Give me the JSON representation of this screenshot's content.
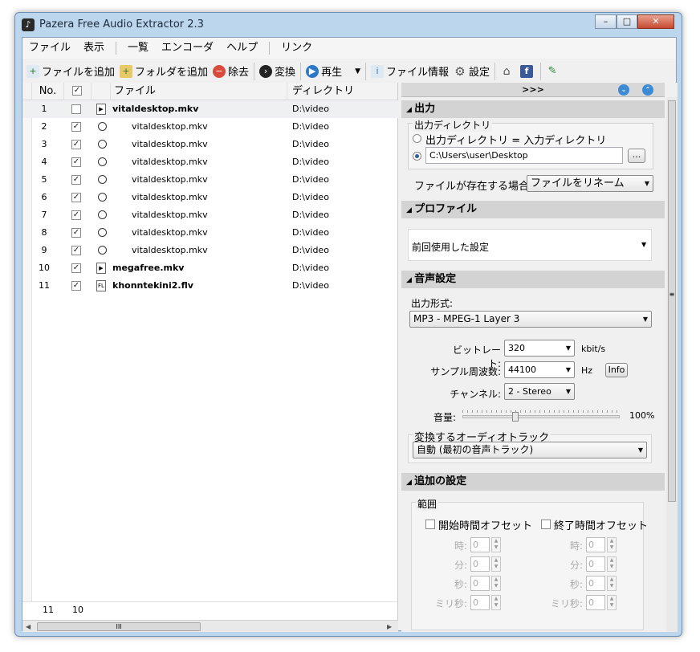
{
  "window": {
    "title": "Pazera Free Audio Extractor 2.3"
  },
  "menu": [
    "ファイル",
    "表示",
    "一覧",
    "エンコーダ",
    "ヘルプ",
    "リンク"
  ],
  "toolbar": {
    "add_file": "ファイルを追加",
    "add_folder": "フォルダを追加",
    "remove": "除去",
    "convert": "変換",
    "play": "再生",
    "file_info": "ファイル情報",
    "settings": "設定"
  },
  "list": {
    "headers": {
      "no": "No.",
      "file": "ファイル",
      "dir": "ディレクトリ"
    },
    "rows": [
      {
        "no": "1",
        "checked": false,
        "type": "mkv",
        "name": "vitaldesktop.mkv",
        "dir": "D:\\video",
        "bold": true,
        "child": false
      },
      {
        "no": "2",
        "checked": true,
        "type": "clock",
        "name": "vitaldesktop.mkv",
        "dir": "D:\\video",
        "bold": false,
        "child": true
      },
      {
        "no": "3",
        "checked": true,
        "type": "clock",
        "name": "vitaldesktop.mkv",
        "dir": "D:\\video",
        "bold": false,
        "child": true
      },
      {
        "no": "4",
        "checked": true,
        "type": "clock",
        "name": "vitaldesktop.mkv",
        "dir": "D:\\video",
        "bold": false,
        "child": true
      },
      {
        "no": "5",
        "checked": true,
        "type": "clock",
        "name": "vitaldesktop.mkv",
        "dir": "D:\\video",
        "bold": false,
        "child": true
      },
      {
        "no": "6",
        "checked": true,
        "type": "clock",
        "name": "vitaldesktop.mkv",
        "dir": "D:\\video",
        "bold": false,
        "child": true
      },
      {
        "no": "7",
        "checked": true,
        "type": "clock",
        "name": "vitaldesktop.mkv",
        "dir": "D:\\video",
        "bold": false,
        "child": true
      },
      {
        "no": "8",
        "checked": true,
        "type": "clock",
        "name": "vitaldesktop.mkv",
        "dir": "D:\\video",
        "bold": false,
        "child": true
      },
      {
        "no": "9",
        "checked": true,
        "type": "clock",
        "name": "vitaldesktop.mkv",
        "dir": "D:\\video",
        "bold": false,
        "child": true
      },
      {
        "no": "10",
        "checked": true,
        "type": "mkv",
        "name": "megafree.mkv",
        "dir": "D:\\video",
        "bold": true,
        "child": false
      },
      {
        "no": "11",
        "checked": true,
        "type": "flv",
        "name": "khonntekini2.flv",
        "dir": "D:\\video",
        "bold": true,
        "child": false
      }
    ],
    "footer": {
      "total": "11",
      "checked": "10"
    }
  },
  "panel": {
    "top_label": ">>>",
    "output": {
      "title": "出力",
      "dir_group": "出力ディレクトリ",
      "radio_same": "出力ディレクトリ = 入力ディレクトリ",
      "path": "C:\\Users\\user\\Desktop",
      "browse": "...",
      "exists_label": "ファイルが存在する場合:",
      "exists_value": "ファイルをリネーム"
    },
    "profile": {
      "title": "プロファイル",
      "value": "前回使用した設定"
    },
    "audio": {
      "title": "音声設定",
      "format_label": "出力形式:",
      "format_value": "MP3 - MPEG-1 Layer 3",
      "bitrate_label": "ビットレート:",
      "bitrate_value": "320",
      "bitrate_unit": "kbit/s",
      "rate_label": "サンプル周波数:",
      "rate_value": "44100",
      "rate_unit": "Hz",
      "info_button": "Info",
      "channel_label": "チャンネル:",
      "channel_value": "2 - Stereo",
      "volume_label": "音量:",
      "volume_value": "100%",
      "track_group": "変換するオーディオトラック",
      "track_value": "自動 (最初の音声トラック)"
    },
    "extra": {
      "title": "追加の設定",
      "range_group": "範囲",
      "start_offset": "開始時間オフセット",
      "end_offset": "終了時間オフセット",
      "hour": "時:",
      "minute": "分:",
      "second": "秒:",
      "ms": "ミリ秒:",
      "zero": "0"
    }
  }
}
